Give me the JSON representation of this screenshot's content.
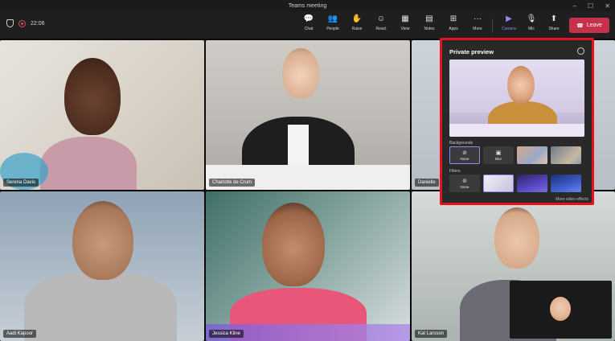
{
  "window": {
    "title": "Teams meeting",
    "controls": [
      "–",
      "☐",
      "✕"
    ]
  },
  "toolbar": {
    "timer": "22:06",
    "buttons": [
      {
        "label": "Chat",
        "icon": "chat-icon",
        "glyph": "💬"
      },
      {
        "label": "People",
        "icon": "people-icon",
        "glyph": "👥"
      },
      {
        "label": "Raise",
        "icon": "raise-hand-icon",
        "glyph": "✋"
      },
      {
        "label": "React",
        "icon": "react-icon",
        "glyph": "☺"
      },
      {
        "label": "View",
        "icon": "view-icon",
        "glyph": "▦"
      },
      {
        "label": "Notes",
        "icon": "notes-icon",
        "glyph": "▤"
      },
      {
        "label": "Apps",
        "icon": "apps-icon",
        "glyph": "⊞"
      },
      {
        "label": "More",
        "icon": "more-icon",
        "glyph": "···"
      },
      {
        "label": "Camera",
        "icon": "camera-icon",
        "glyph": "▶"
      },
      {
        "label": "Mic",
        "icon": "mic-icon",
        "glyph": "🎙"
      },
      {
        "label": "Share",
        "icon": "share-icon",
        "glyph": "⬆"
      }
    ],
    "leave_label": "Leave",
    "active_color": "#8b8cf5",
    "leave_color": "#c4314b"
  },
  "participants": [
    {
      "name": "Serena Davis"
    },
    {
      "name": "Charlotte de Crum"
    },
    {
      "name": "Danielle"
    },
    {
      "name": "Aadi Kapoor"
    },
    {
      "name": "Jessica Kline"
    },
    {
      "name": "Kat Larsson"
    }
  ],
  "preview_panel": {
    "title": "Private preview",
    "backgrounds_label": "Backgrounds",
    "filters_label": "Filters",
    "background_options": [
      {
        "label": "None",
        "glyph": "⊘"
      },
      {
        "label": "Blur",
        "glyph": "▣"
      },
      {
        "label": "",
        "glyph": ""
      },
      {
        "label": "",
        "glyph": ""
      }
    ],
    "filter_options": [
      {
        "label": "None",
        "glyph": "⊘"
      },
      {
        "label": "",
        "glyph": ""
      },
      {
        "label": "",
        "glyph": ""
      },
      {
        "label": "",
        "glyph": ""
      }
    ],
    "more_link": "More video effects",
    "highlight_color": "#e8101f"
  }
}
